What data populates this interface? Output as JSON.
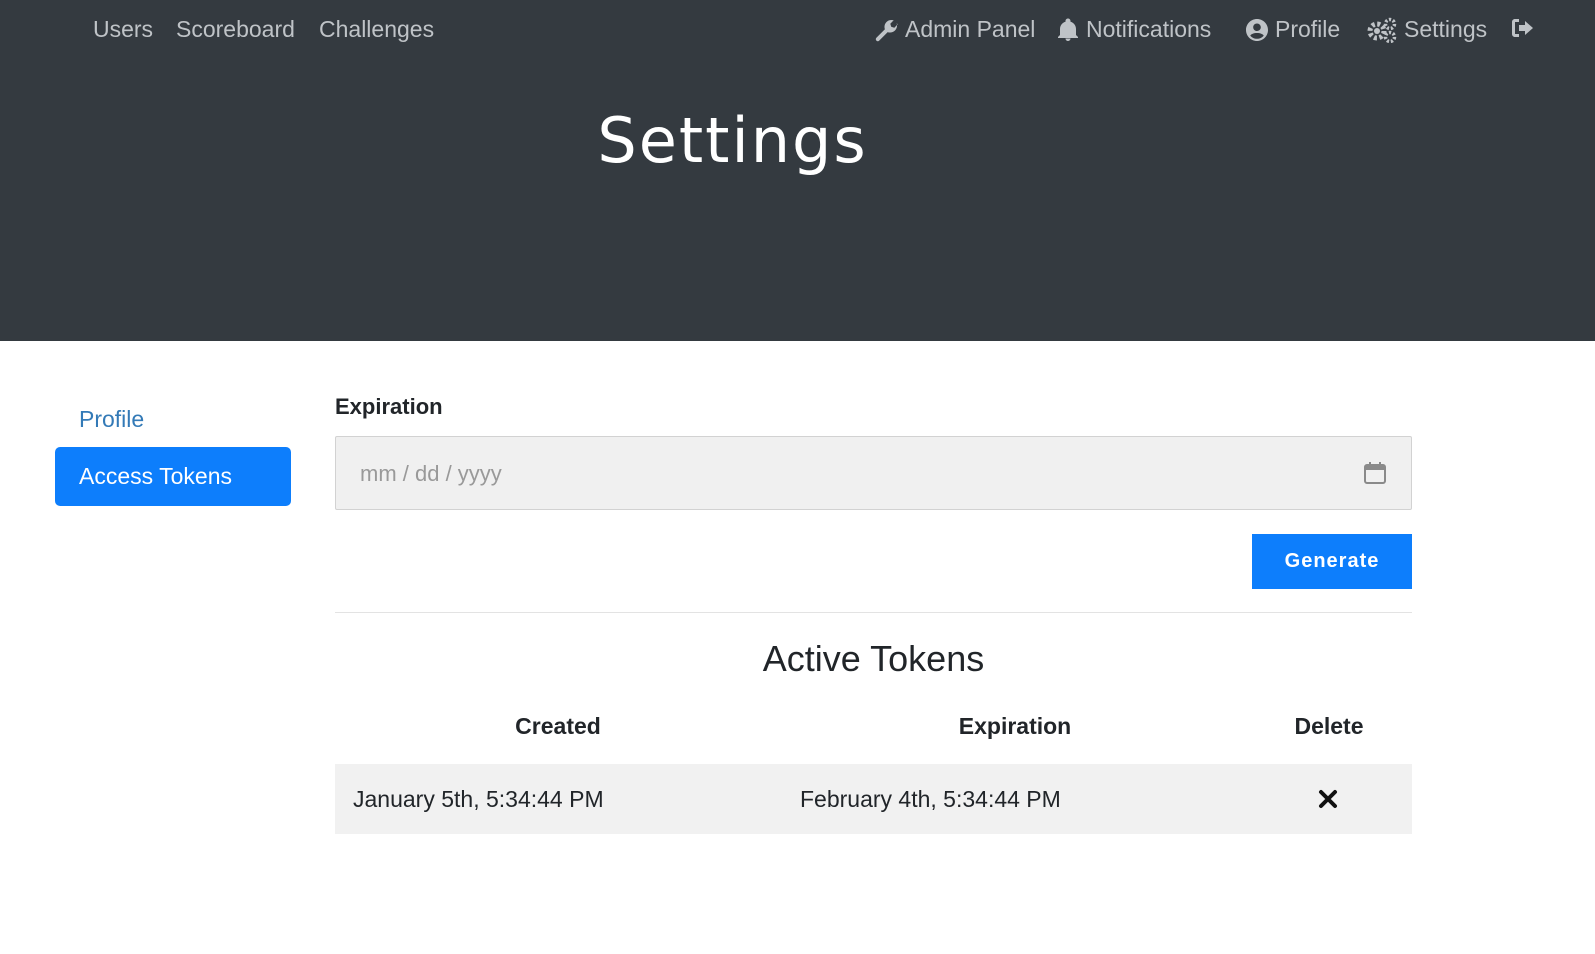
{
  "nav": {
    "left": [
      "Users",
      "Scoreboard",
      "Challenges"
    ],
    "admin_panel": "Admin Panel",
    "notifications": "Notifications",
    "profile": "Profile",
    "settings": "Settings"
  },
  "page": {
    "title": "Settings"
  },
  "sidebar": {
    "items": [
      {
        "label": "Profile",
        "active": false
      },
      {
        "label": "Access Tokens",
        "active": true
      }
    ]
  },
  "form": {
    "expiration_label": "Expiration",
    "expiration_placeholder": "mm / dd / yyyy",
    "generate_label": "Generate"
  },
  "tokens": {
    "title": "Active Tokens",
    "headers": [
      "Created",
      "Expiration",
      "Delete"
    ],
    "rows": [
      {
        "created": "January 5th, 5:34:44 PM",
        "expiration": "February 4th, 5:34:44 PM"
      }
    ]
  },
  "colors": {
    "nav_bg": "#343a40",
    "accent": "#0d7efc",
    "link": "#337ab7"
  }
}
